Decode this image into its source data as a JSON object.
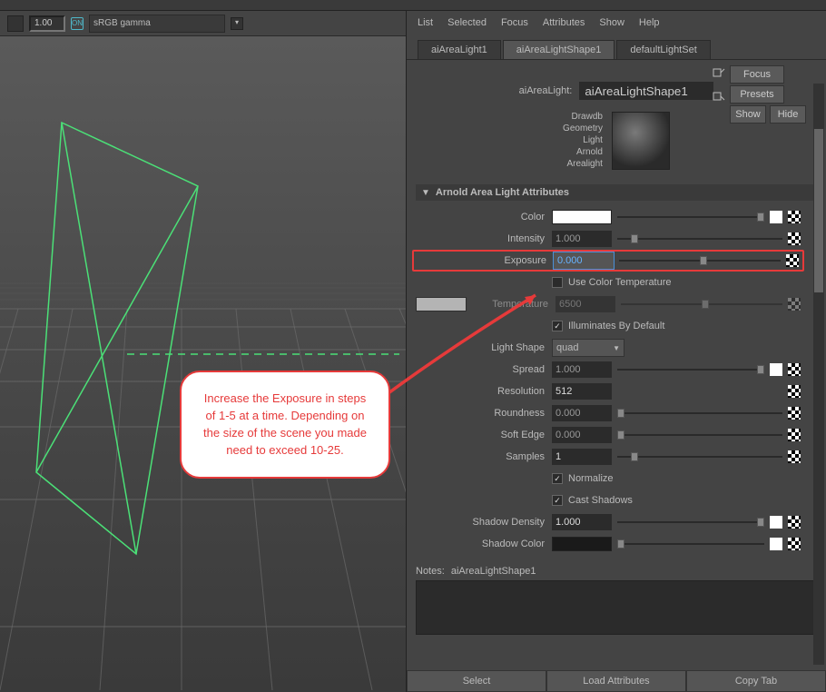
{
  "topbar_num": "1.00",
  "srgb_label": "sRGB gamma",
  "menu": {
    "list": "List",
    "selected": "Selected",
    "focus": "Focus",
    "attributes": "Attributes",
    "show": "Show",
    "help": "Help"
  },
  "tabs": [
    {
      "label": "aiAreaLight1",
      "active": false
    },
    {
      "label": "aiAreaLightShape1",
      "active": true
    },
    {
      "label": "defaultLightSet",
      "active": false
    }
  ],
  "node": {
    "label": "aiAreaLight:",
    "value": "aiAreaLightShape1"
  },
  "r_buttons": {
    "focus": "Focus",
    "presets": "Presets",
    "show": "Show",
    "hide": "Hide"
  },
  "preview_labels": [
    "Drawdb",
    "Geometry",
    "Light",
    "Arnold",
    "Arealight"
  ],
  "section_title": "Arnold Area Light Attributes",
  "attrs": {
    "color": {
      "label": "Color"
    },
    "intensity": {
      "label": "Intensity",
      "value": "1.000"
    },
    "exposure": {
      "label": "Exposure",
      "value": "0.000"
    },
    "use_ct": {
      "label": "Use Color Temperature",
      "checked": false
    },
    "temperature": {
      "label": "Temperature",
      "value": "6500"
    },
    "illum": {
      "label": "Illuminates By Default",
      "checked": true
    },
    "light_shape": {
      "label": "Light Shape",
      "value": "quad"
    },
    "spread": {
      "label": "Spread",
      "value": "1.000"
    },
    "resolution": {
      "label": "Resolution",
      "value": "512"
    },
    "roundness": {
      "label": "Roundness",
      "value": "0.000"
    },
    "soft_edge": {
      "label": "Soft Edge",
      "value": "0.000"
    },
    "samples": {
      "label": "Samples",
      "value": "1"
    },
    "normalize": {
      "label": "Normalize",
      "checked": true
    },
    "cast_shadows": {
      "label": "Cast Shadows",
      "checked": true
    },
    "shadow_density": {
      "label": "Shadow Density",
      "value": "1.000"
    },
    "shadow_color": {
      "label": "Shadow Color"
    }
  },
  "notes": {
    "label": "Notes:",
    "name": "aiAreaLightShape1"
  },
  "bottom": {
    "select": "Select",
    "load": "Load Attributes",
    "copy": "Copy Tab"
  },
  "callout": "Increase the Exposure in steps of 1-5 at a time. Depending on the size of the scene you made need to exceed 10-25."
}
